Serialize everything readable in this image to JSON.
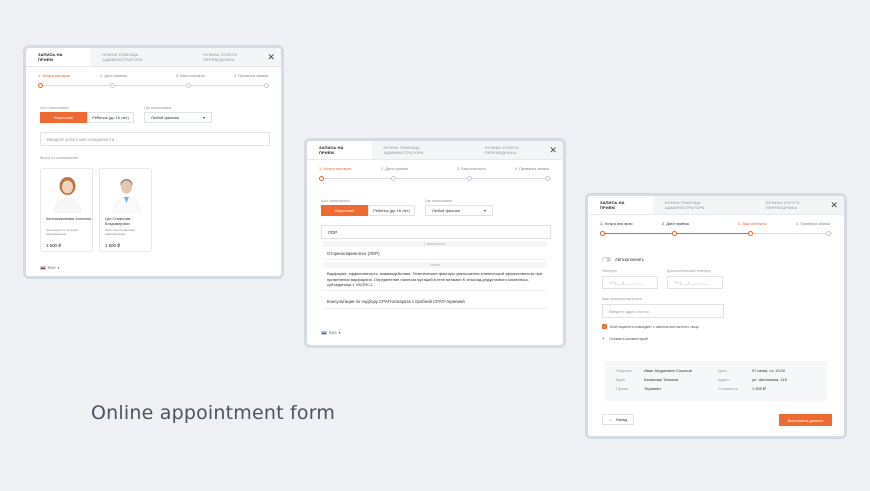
{
  "caption": "Online appointment form",
  "tabs": {
    "booking": "Запись на прием",
    "admin_help": "Нужна помощь администратора",
    "translator": "Нужны услуги переводчика"
  },
  "steps": [
    "1. Услуга или врач",
    "2. Дата приёма",
    "3. Ваш контакты",
    "4. Проверка заявки"
  ],
  "form1": {
    "who_label": "Кого записываем",
    "who_options": [
      "Взрослый",
      "Ребенок (до 16 лет)"
    ],
    "branch_label": "Где записываем",
    "branch_value": "Любой филиал",
    "search_placeholder": "Введите услугу или специалиста",
    "doctors_label": "Врачи по записывание",
    "doctors": [
      {
        "name": "Котельникевская Ангелина",
        "spec": "фонтандиолог высшей квалификации",
        "price": "1 500 ₽"
      },
      {
        "name": "Цех Станислав Владимирович",
        "spec": "врач-хирурга высшей квалификации",
        "price": "1 500 ₽"
      }
    ],
    "lang": "RUS"
  },
  "form2": {
    "search_value": "ЛОР",
    "section_spec": "Специалисты",
    "spec_result": "Оториноларинголог (ЛОР)",
    "section_services": "Услуги",
    "service1": "Варфарин: эффективность, взаимодействия. Генетические факторы уменьшения клинической эффективности при применении варфарина. Определение наличия мутаций в гене витамин K эпоксид-редуктазного комплекса, субъединица 1 VKORC1.",
    "service2": "Консультация по подбору СРАП-аппарата с пробной СРАП-терапией",
    "lang": "RUS",
    "who_options": [
      "Взрослый",
      "Ребенок (до 16 лет)"
    ],
    "branch_value": "Любой филиал"
  },
  "form3": {
    "autofill": "Автозаполнить",
    "phone_label": "Телефон",
    "extra_phone_label": "Дополнительный телефон",
    "phone_placeholder": "+7 (___) ___-__-__",
    "email_label": "Ваш электронная почта",
    "email_placeholder": "Введите адрес почты",
    "consent": "Мой пациента совпадает с именем контактного лица",
    "add_comment": "Оставить комментарий",
    "summary": {
      "patient_k": "Пациент",
      "patient_v": "Иван Андреевич Соколов",
      "doctor_k": "Врач",
      "doctor_v": "Калинова Татьяна",
      "service_k": "Прием",
      "service_v": "Терапевт",
      "date_k": "Дата",
      "date_v": "07 июня, чт, 13:00",
      "address_k": "Адрес",
      "address_v": "ул. Шеломина, 11б",
      "cost_k": "Стоимость",
      "cost_v": "1 500 ₽"
    },
    "back": "Назад",
    "submit": "Выполнить данные"
  }
}
